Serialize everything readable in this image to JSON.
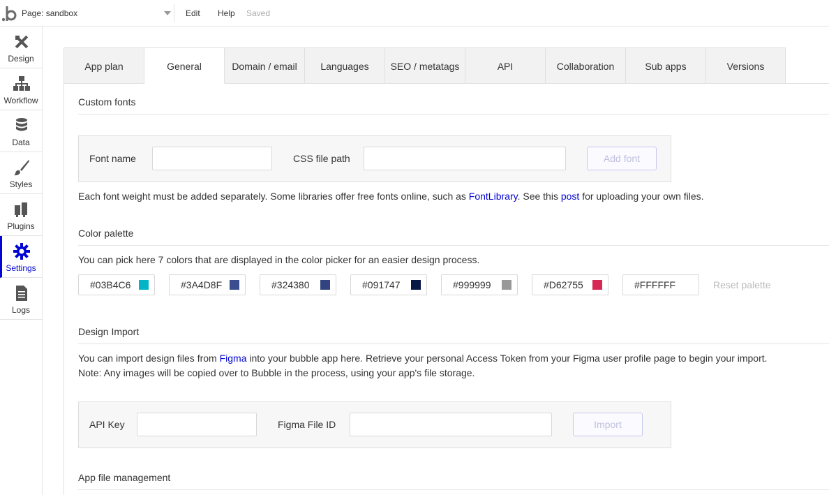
{
  "topbar": {
    "logo_text": "b",
    "page_label": "Page: sandbox",
    "menu_edit": "Edit",
    "menu_help": "Help",
    "status": "Saved"
  },
  "sidebar": {
    "items": [
      {
        "label": "Design",
        "icon": "design-icon"
      },
      {
        "label": "Workflow",
        "icon": "workflow-icon"
      },
      {
        "label": "Data",
        "icon": "database-icon"
      },
      {
        "label": "Styles",
        "icon": "brush-icon"
      },
      {
        "label": "Plugins",
        "icon": "plug-icon"
      },
      {
        "label": "Settings",
        "icon": "gear-icon",
        "active": true
      },
      {
        "label": "Logs",
        "icon": "document-icon"
      }
    ],
    "active_color": "#0205D3"
  },
  "tabs": [
    "App plan",
    "General",
    "Domain / email",
    "Languages",
    "SEO / metatags",
    "API",
    "Collaboration",
    "Sub apps",
    "Versions"
  ],
  "active_tab": "General",
  "custom_fonts": {
    "title": "Custom fonts",
    "font_name_label": "Font name",
    "font_name_value": "",
    "css_path_label": "CSS file path",
    "css_path_value": "",
    "add_button": "Add font",
    "help_before": "Each font weight must be added separately. Some libraries offer free fonts online, such as ",
    "help_link1": "FontLibrary",
    "help_middle": ". See this ",
    "help_link2": "post",
    "help_after": " for uploading your own files."
  },
  "color_palette": {
    "title": "Color palette",
    "description": "You can pick here 7 colors that are displayed in the color picker for an easier design process.",
    "colors": [
      {
        "hex": "#03B4C6",
        "swatch": "#03B4C6"
      },
      {
        "hex": "#3A4D8F",
        "swatch": "#3A4D8F"
      },
      {
        "hex": "#324380",
        "swatch": "#324380"
      },
      {
        "hex": "#091747",
        "swatch": "#091747"
      },
      {
        "hex": "#999999",
        "swatch": "#999999"
      },
      {
        "hex": "#D62755",
        "swatch": "#D62755"
      },
      {
        "hex": "#FFFFFF",
        "swatch": "#FFFFFF"
      }
    ],
    "reset_label": "Reset palette"
  },
  "design_import": {
    "title": "Design Import",
    "line1_before": "You can import design files from ",
    "line1_link": "Figma",
    "line1_after": " into your bubble app here. Retrieve your personal Access Token from your Figma user profile page to begin your import.",
    "line2": "Note: Any images will be copied over to Bubble in the process, using your app's file storage.",
    "api_key_label": "API Key",
    "api_key_value": "",
    "figma_id_label": "Figma File ID",
    "figma_id_value": "",
    "import_button": "Import"
  },
  "app_file_management": {
    "title": "App file management"
  }
}
